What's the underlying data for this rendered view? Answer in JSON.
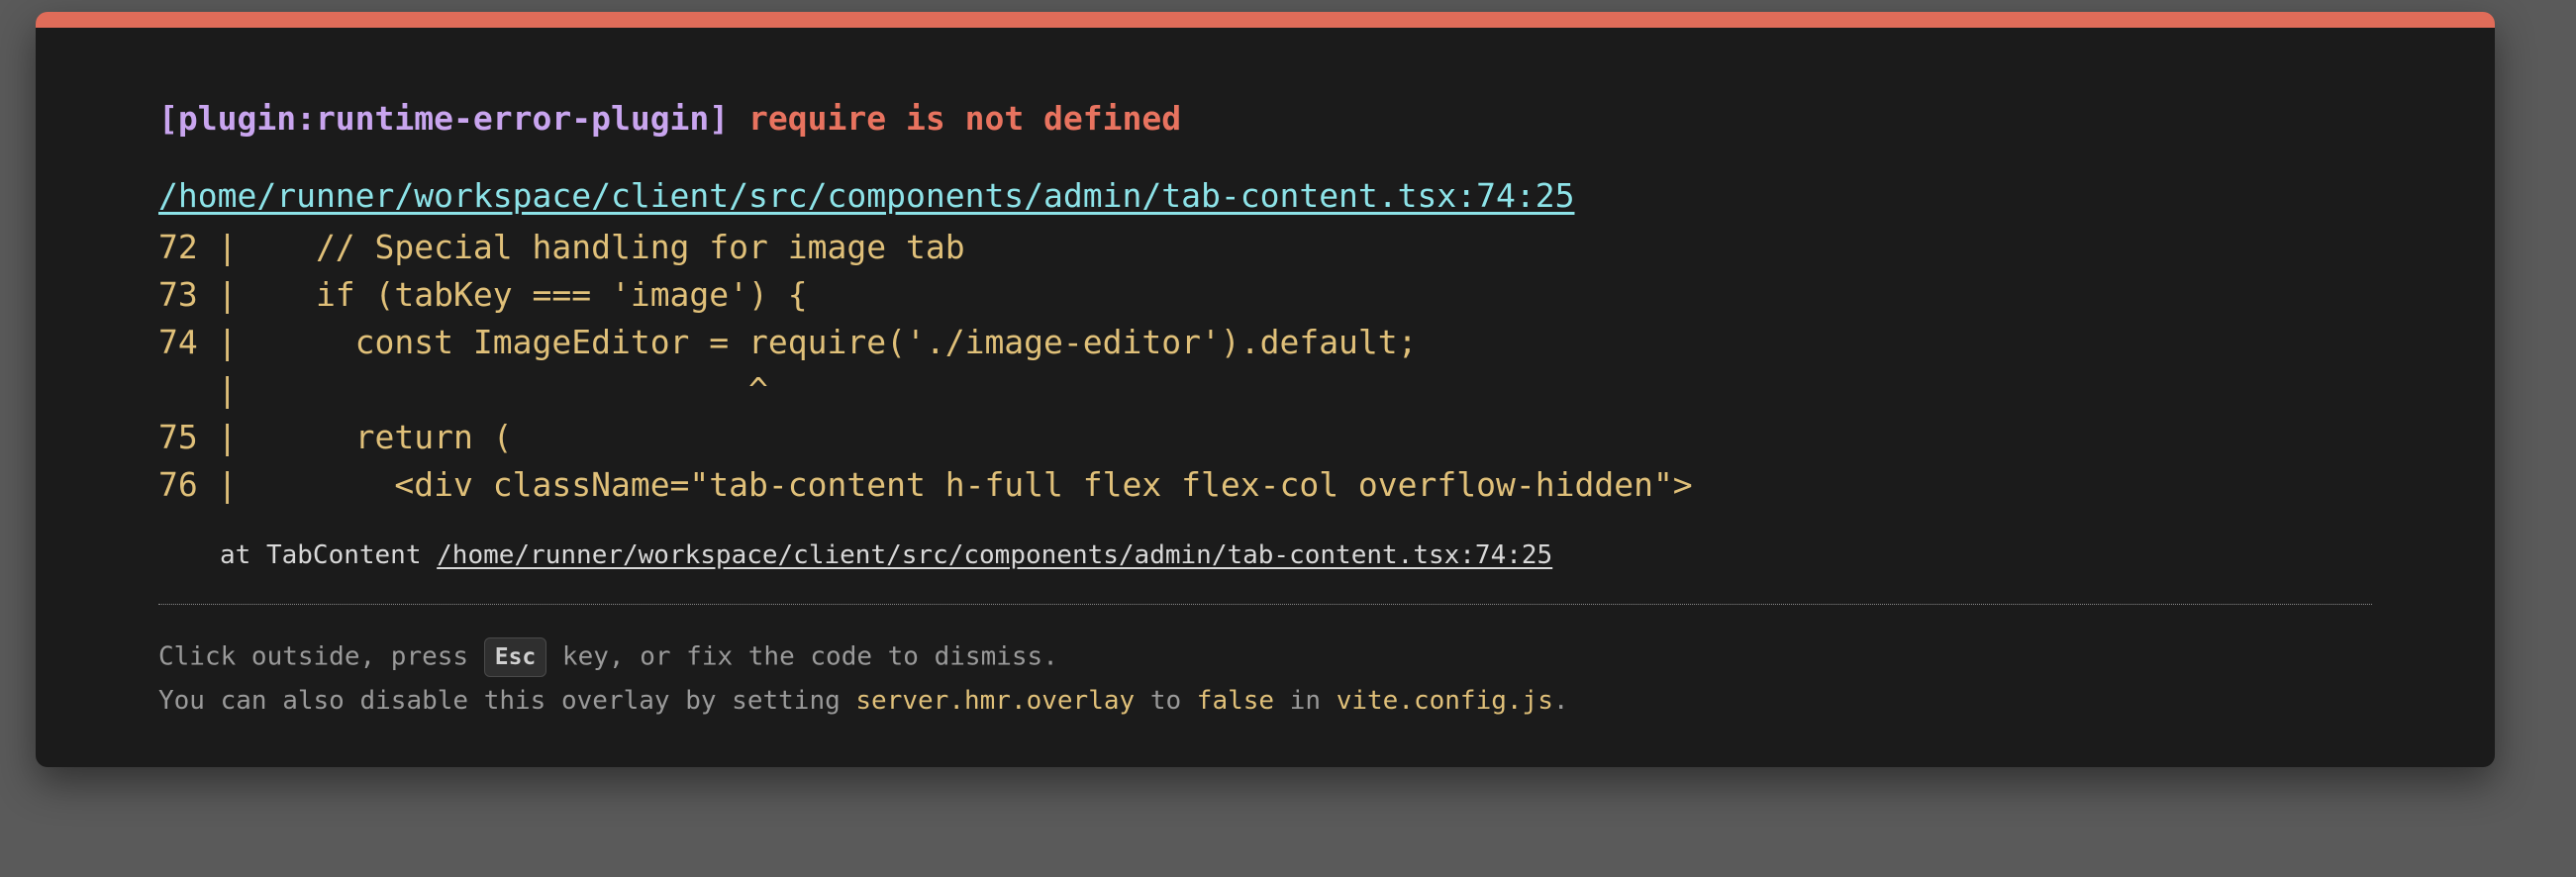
{
  "error": {
    "plugin": "[plugin:runtime-error-plugin]",
    "message": "require is not defined"
  },
  "file": "/home/runner/workspace/client/src/components/admin/tab-content.tsx:74:25",
  "code_frame": [
    "72 |    // Special handling for image tab",
    "73 |    if (tabKey === 'image') {",
    "74 |      const ImageEditor = require('./image-editor').default;",
    "   |                          ^",
    "75 |      return (",
    "76 |        <div className=\"tab-content h-full flex flex-col overflow-hidden\">"
  ],
  "stack": {
    "prefix": "at TabContent ",
    "link": "/home/runner/workspace/client/src/components/admin/tab-content.tsx:74:25"
  },
  "tips": {
    "line1_before": "Click outside, press ",
    "esc_key": "Esc",
    "line1_after": " key, or fix the code to dismiss.",
    "line2_a": "You can also disable this overlay by setting ",
    "line2_code1": "server.hmr.overlay",
    "line2_b": " to ",
    "line2_code2": "false",
    "line2_c": " in ",
    "line2_code3": "vite.config.js",
    "line2_d": "."
  },
  "colors": {
    "accent_border": "#e06c59",
    "plugin_tag": "#c9a5ef",
    "error_message": "#e8735f",
    "file_link": "#8de3e8",
    "code": "#e0c079"
  }
}
